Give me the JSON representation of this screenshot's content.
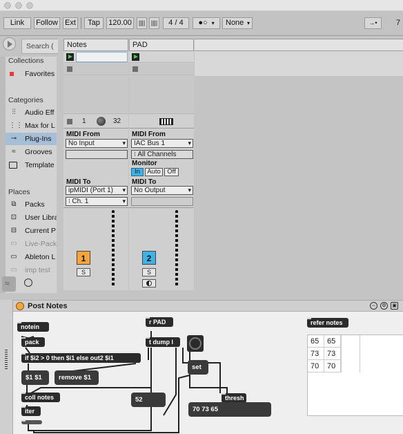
{
  "transport": {
    "link": "Link",
    "follow": "Follow",
    "ext": "Ext",
    "tap": "Tap",
    "tempo": "120.00",
    "time_sig": "4 / 4",
    "metronome_icon": "metronome-dots-icon",
    "quantize": "None",
    "right_num": "7"
  },
  "browser": {
    "search_placeholder": "Search (",
    "collections_header": "Collections",
    "favorites": "Favorites",
    "categories_header": "Categories",
    "categories": [
      "Audio Eff",
      "Max for L",
      "Plug-Ins",
      "Grooves",
      "Template"
    ],
    "places_header": "Places",
    "places": [
      "Packs",
      "User Libra",
      "Current P",
      "Live-Pack",
      "Ableton L",
      "imp test"
    ]
  },
  "tracks": [
    {
      "name": "Notes",
      "clip_left": "1",
      "clip_right": "32",
      "midi_from_label": "MIDI From",
      "midi_from_value": "No Input",
      "midi_to_label": "MIDI To",
      "midi_to_value": "ipMIDI (Port 1)",
      "channel": "Ch. 1",
      "number": "1",
      "solo": "S",
      "color": "#f5a53a"
    },
    {
      "name": "PAD",
      "midi_from_label": "MIDI From",
      "midi_from_value": "IAC Bus 1",
      "channels": "All Channels",
      "monitor_label": "Monitor",
      "monitor_in": "In",
      "monitor_auto": "Auto",
      "monitor_off": "Off",
      "midi_to_label": "MIDI To",
      "midi_to_value": "No Output",
      "number": "2",
      "solo": "S",
      "color": "#3fb3e6"
    }
  ],
  "device": {
    "title": "Post Notes",
    "objects": {
      "notein": "notein",
      "pack": "pack",
      "ifexpr": "if $i2 > 0 then $i1 else out2 $i1",
      "msg11": "$1 $1",
      "remove": "remove $1",
      "coll": "coll notes",
      "iter": "iter",
      "rpad": "r PAD",
      "tdump": "t dump l",
      "set": "set",
      "thresh": "thresh",
      "num52": "52",
      "list": "70 73 65",
      "refer": "refer notes"
    },
    "table": [
      [
        "65",
        "65"
      ],
      [
        "73",
        "73"
      ],
      [
        "70",
        "70"
      ]
    ]
  }
}
